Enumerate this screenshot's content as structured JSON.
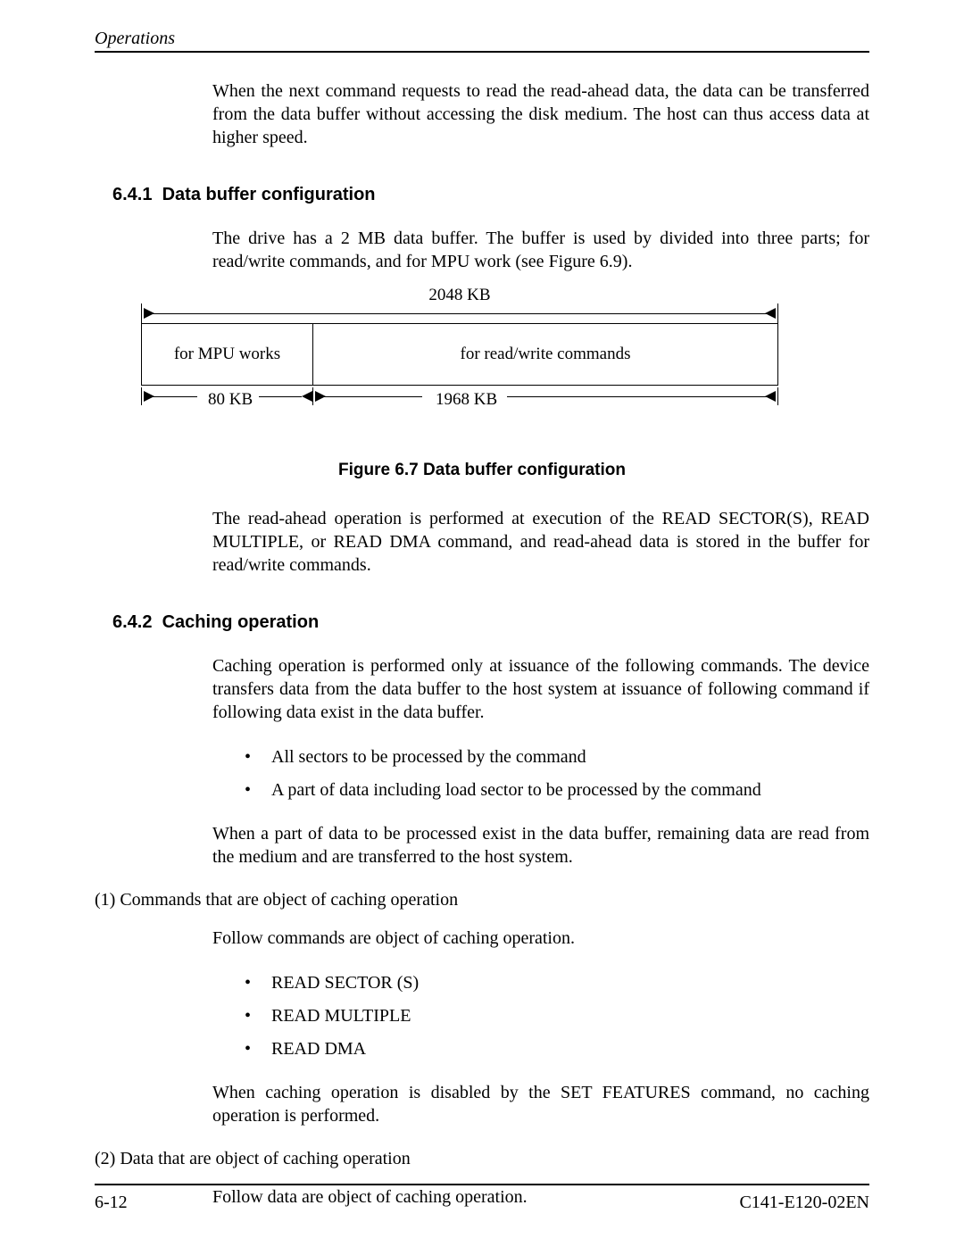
{
  "header": {
    "title": "Operations"
  },
  "intro": "When the next command requests to read the read-ahead data, the data can be transferred from the data buffer without accessing the disk medium.  The host can thus access data at higher speed.",
  "section_641": {
    "number": "6.4.1",
    "title": "Data buffer configuration",
    "text": "The drive has a 2 MB data buffer.  The buffer is used by divided into three parts; for read/write commands, and for MPU work (see Figure 6.9).",
    "post_fig": "The read-ahead operation is performed at execution of the READ SECTOR(S), READ MULTIPLE, or READ DMA command, and read-ahead data is stored in the buffer for read/write commands."
  },
  "figure": {
    "total": "2048 KB",
    "left_box": "for MPU works",
    "right_box": "for read/write commands",
    "left_size": "80 KB",
    "right_size": "1968 KB",
    "caption": "Figure 6.7  Data buffer configuration"
  },
  "section_642": {
    "number": "6.4.2",
    "title": "Caching operation",
    "p1": "Caching operation is performed only at issuance of the following commands.  The device transfers data from the data buffer to the host system at issuance of following command if following data exist in the data buffer.",
    "bullets1": [
      "All sectors to be processed by the command",
      "A part of data including load sector to be processed by the command"
    ],
    "p2": "When a part of data to be processed exist in the data buffer, remaining data are read from the medium and are transferred to the host system.",
    "sub1_label": "(1)  Commands that are object of caching operation",
    "sub1_intro": "Follow commands are object of caching operation.",
    "sub1_bullets": [
      "READ SECTOR (S)",
      "READ MULTIPLE",
      "READ DMA"
    ],
    "sub1_post": "When caching operation is disabled by the SET FEATURES command, no caching operation is performed.",
    "sub2_label": "(2)  Data that are object of caching operation",
    "sub2_intro": "Follow data are object of caching operation."
  },
  "footer": {
    "page": "6-12",
    "doc": "C141-E120-02EN"
  },
  "chart_data": {
    "type": "bar",
    "title": "Data buffer configuration",
    "categories": [
      "for MPU works",
      "for read/write commands"
    ],
    "values": [
      80,
      1968
    ],
    "unit": "KB",
    "total": 2048
  }
}
